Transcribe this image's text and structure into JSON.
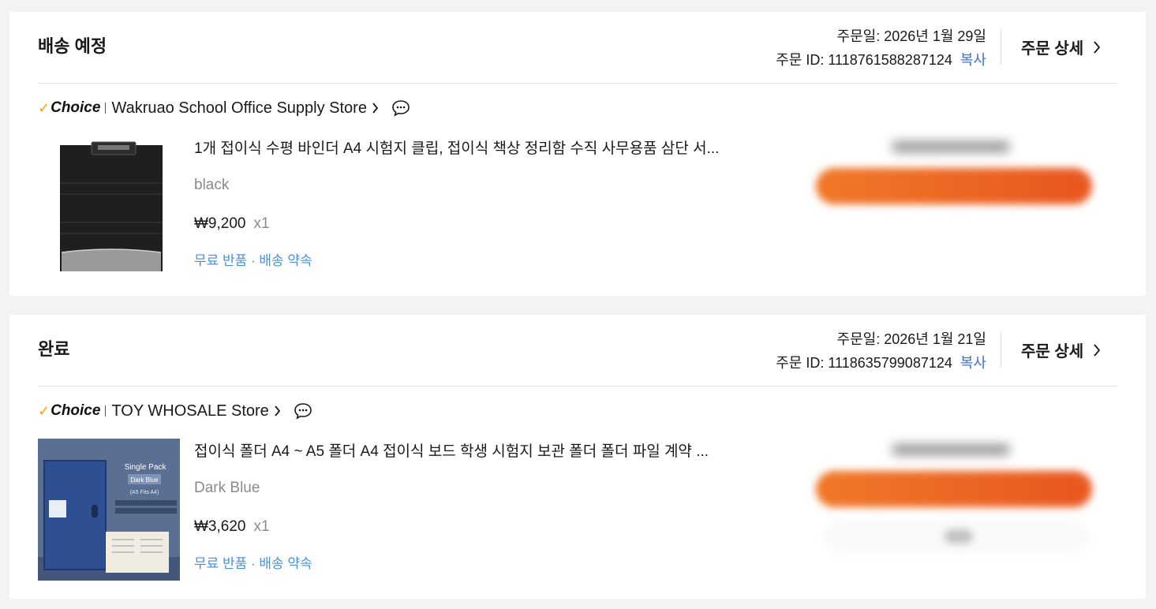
{
  "orders": [
    {
      "status": "배송 예정",
      "order_date": "주문일: 2026년 1월 29일",
      "order_id": "주문 ID: 1118761588287124",
      "copy_label": "복사",
      "detail_label": "주문 상세",
      "choice_label": "Choice",
      "store": "Wakruao School Office Supply Store",
      "product_title": "1개 접이식 수평 바인더 A4 시험지 클립, 접이식 책상 정리함 수직 사무용품 삼단 서...",
      "variant": "black",
      "price": "₩9,200",
      "qty": "x1",
      "service": "무료 반품 · 배송 약속"
    },
    {
      "status": "완료",
      "order_date": "주문일: 2026년 1월 21일",
      "order_id": "주문 ID: 1118635799087124",
      "copy_label": "복사",
      "detail_label": "주문 상세",
      "choice_label": "Choice",
      "store": "TOY WHOSALE Store",
      "product_title": "접이식 폴더 A4 ~ A5 폴더 A4 접이식 보드 학생 시험지 보관 폴더 폴더 파일 계약 ...",
      "variant": "Dark Blue",
      "price": "₩3,620",
      "qty": "x1",
      "service": "무료 반품 · 배송 약속",
      "image_text": {
        "line1": "Single Pack",
        "line2": "Dark Blue",
        "line3": "(A5 Fits A4)"
      }
    }
  ],
  "colors": {
    "accent_orange": "#e8561e",
    "link_blue": "#3b6fd4",
    "service_blue": "#4a90d9",
    "choice_check": "#f2a013"
  }
}
